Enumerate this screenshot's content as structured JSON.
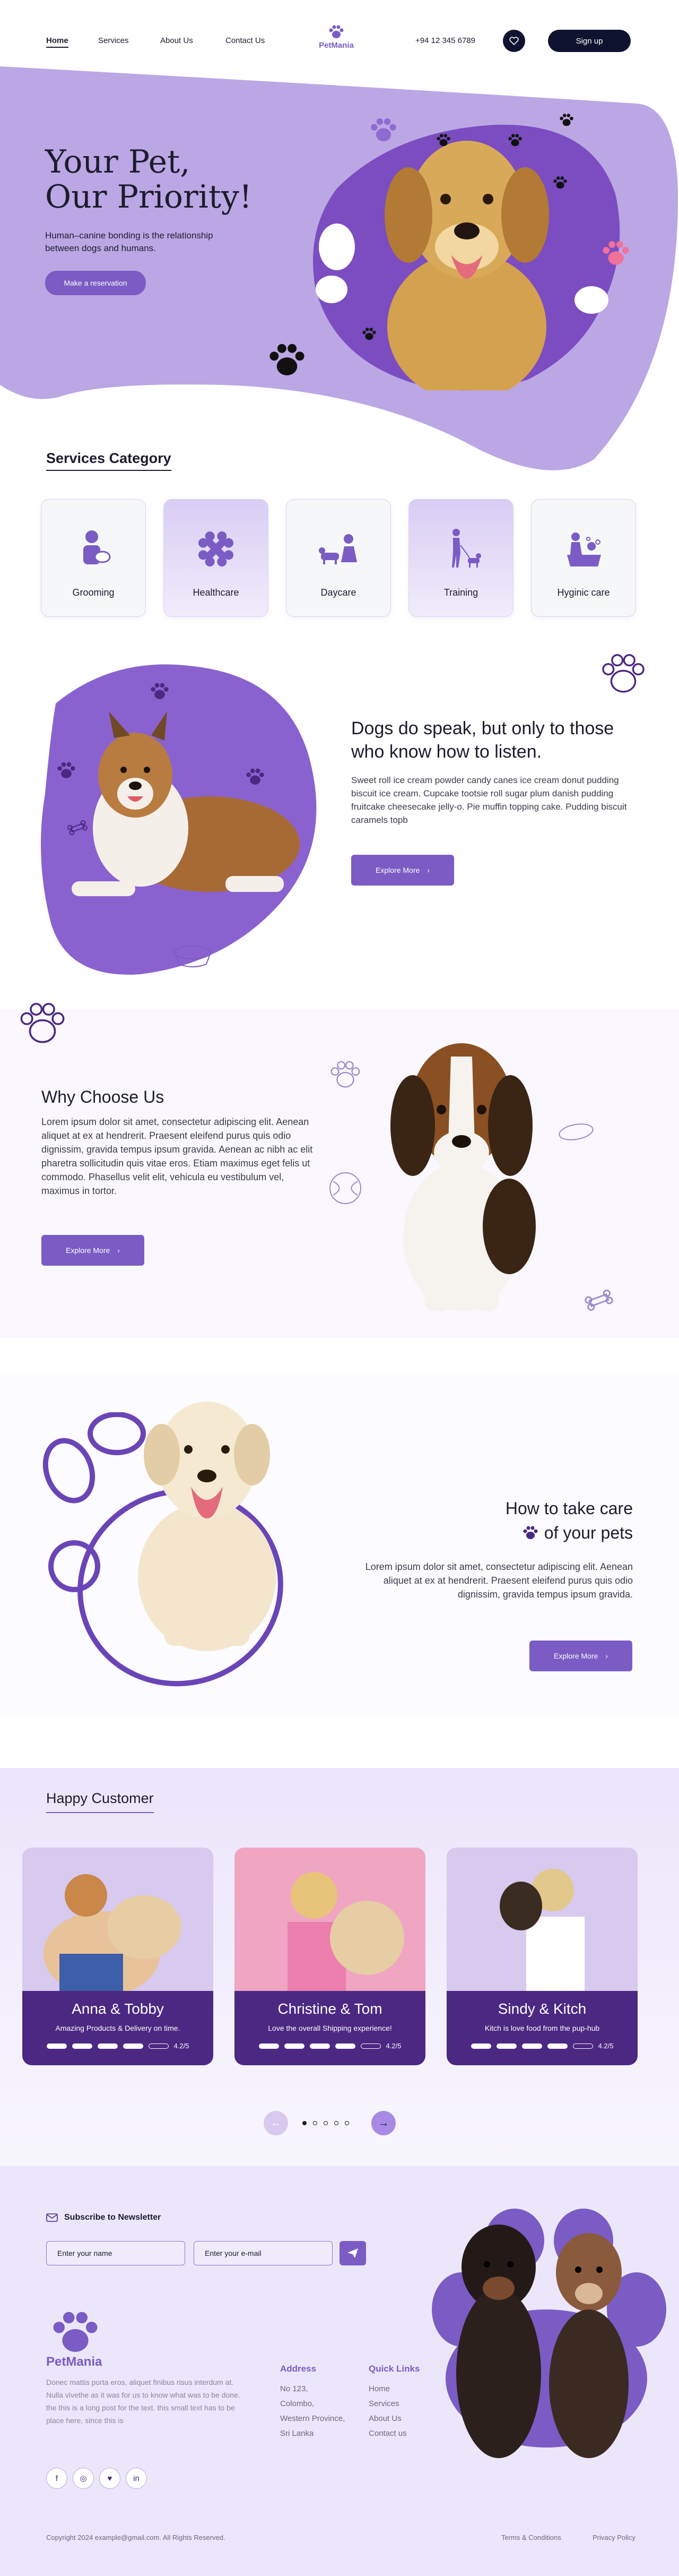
{
  "nav": {
    "links": [
      "Home",
      "Services",
      "About Us",
      "Contact Us"
    ],
    "brand": "PetMania",
    "phone": "+94 12 345 6789",
    "signup": "Sign up"
  },
  "hero": {
    "title_line1": "Your Pet,",
    "title_line2": "Our Priority!",
    "subtitle_line1": "Human–canine bonding is the relationship",
    "subtitle_line2": "between dogs and humans.",
    "cta": "Make a reservation"
  },
  "services": {
    "heading": "Services Category",
    "items": [
      {
        "label": "Grooming",
        "icon": "grooming-icon"
      },
      {
        "label": "Healthcare",
        "icon": "bone-icon"
      },
      {
        "label": "Daycare",
        "icon": "daycare-icon"
      },
      {
        "label": "Training",
        "icon": "training-icon"
      },
      {
        "label": "Hyginic care",
        "icon": "bath-icon"
      }
    ]
  },
  "listen": {
    "heading_line1": "Dogs do speak, but only to those",
    "heading_line2": "who know how to listen.",
    "body": "Sweet roll ice cream powder candy canes ice cream donut pudding biscuit ice cream. Cupcake tootsie roll sugar plum danish pudding fruitcake cheesecake jelly-o. Pie muffin topping cake. Pudding biscuit caramels topb",
    "cta": "Explore More"
  },
  "why": {
    "heading": "Why Choose Us",
    "body": "Lorem ipsum dolor sit amet, consectetur adipiscing elit. Aenean aliquet at ex at hendrerit. Praesent eleifend purus quis odio dignissim, gravida tempus ipsum gravida. Aenean ac nibh ac elit pharetra sollicitudin quis vitae eros. Etiam maximus eget felis ut commodo. Phasellus velit elit, vehicula eu vestibulum vel, maximus in tortor.",
    "cta": "Explore More"
  },
  "care": {
    "heading_line1": "How to take care",
    "heading_line2": "of your pets",
    "body": "Lorem ipsum dolor sit amet, consectetur adipiscing elit. Aenean aliquet at ex at hendrerit. Praesent eleifend purus quis odio dignissim, gravida tempus ipsum gravida.",
    "cta": "Explore More"
  },
  "testimonials": {
    "heading": "Happy Customer",
    "cards": [
      {
        "name": "Anna & Tobby",
        "text": "Amazing Products & Delivery on time.",
        "rating": "4.2/5",
        "bg": "#d8c9ef"
      },
      {
        "name": "Christine & Tom",
        "text": "Love the overall Shipping experience!",
        "rating": "4.2/5",
        "bg": "#f0a5c3"
      },
      {
        "name": "Sindy & Kitch",
        "text": "Kitch is love food from the pup-hub",
        "rating": "4.2/5",
        "bg": "#d8c9ef"
      }
    ]
  },
  "footer": {
    "newsletter_label": "Subscribe to Newsletter",
    "name_placeholder": "Enter your name",
    "email_placeholder": "Enter your e-mail",
    "brand": "PetMania",
    "about": "Donec mattis porta eros, aliquet finibus risus interdum at. Nulla vivethe as it was for us to know what was to be done. the this is a long post for the text. this small text has to be place here, since this is",
    "address_heading": "Address",
    "address_lines": [
      "No 123,",
      "Colombo,",
      "Western Province,",
      "Sri Lanka"
    ],
    "links_heading": "Quick Links",
    "links": [
      "Home",
      "Services",
      "About Us",
      "Contact us"
    ],
    "social": [
      "f",
      "◎",
      "♥",
      "in"
    ],
    "copyright": "Copyright 2024 example@gmail.com. All Rights Reserved.",
    "terms": "Terms & Conditions",
    "privacy": "Privacy Policy"
  },
  "colors": {
    "accent": "#7a5cc4",
    "dark": "#4b2882",
    "hero_bg": "#bba7e4",
    "navy": "#0f1330"
  }
}
